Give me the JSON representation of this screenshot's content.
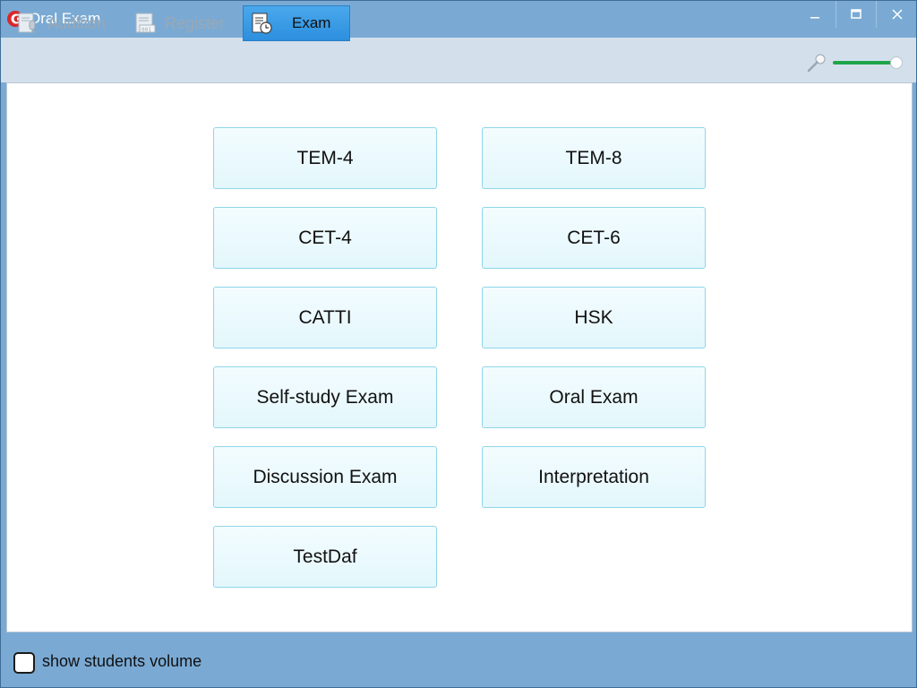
{
  "window": {
    "title": "Oral Exam",
    "controls": {
      "minimize": "–",
      "maximize": "☐",
      "close": "✕"
    }
  },
  "toolbar": {
    "tabs": [
      {
        "label": "Audition",
        "icon": "microphone-document-icon",
        "active": false
      },
      {
        "label": "Register",
        "icon": "register-document-icon",
        "active": false
      },
      {
        "label": "Exam",
        "icon": "exam-clock-document-icon",
        "active": true
      }
    ],
    "volume": {
      "icon": "microphone-icon",
      "level": 1.0,
      "accent": "#1fa54a"
    }
  },
  "exams": [
    {
      "label": "TEM-4"
    },
    {
      "label": "TEM-8"
    },
    {
      "label": "CET-4"
    },
    {
      "label": "CET-6"
    },
    {
      "label": "CATTI"
    },
    {
      "label": "HSK"
    },
    {
      "label": "Self-study Exam"
    },
    {
      "label": "Oral Exam"
    },
    {
      "label": "Discussion Exam"
    },
    {
      "label": "Interpretation"
    },
    {
      "label": "TestDaf"
    }
  ],
  "footer": {
    "show_students_volume": {
      "label": "show students volume",
      "checked": false
    }
  },
  "colors": {
    "titlebar": "#7aaad4",
    "toolbar": "#d3e0ec",
    "active_tab": "#2c8fde",
    "exam_button_border": "#8fd6e8",
    "exam_button_fill": "#eaf9fd"
  }
}
